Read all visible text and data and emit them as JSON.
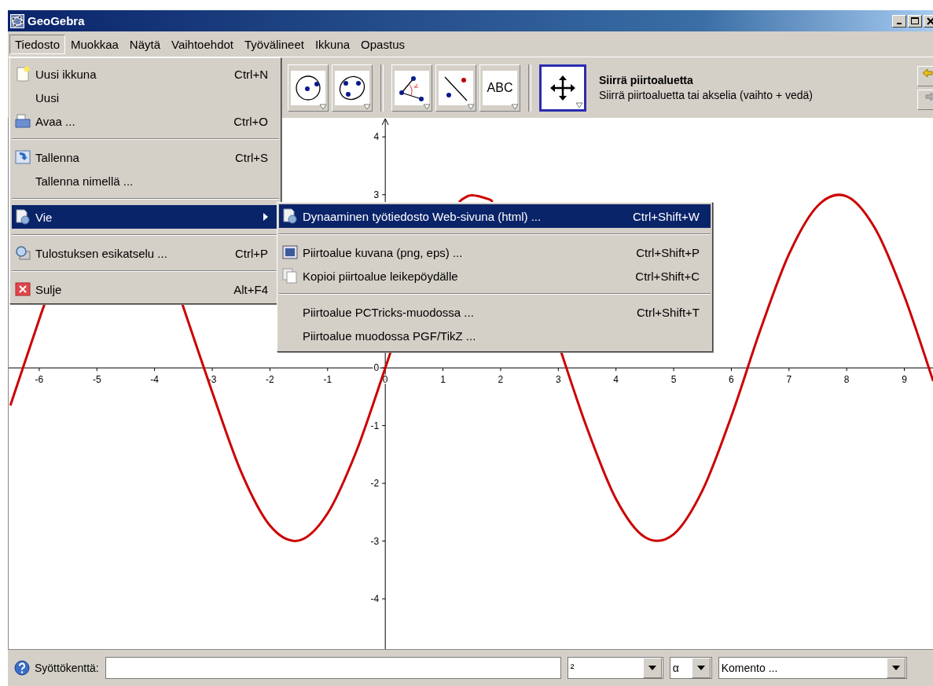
{
  "window": {
    "title": "GeoGebra"
  },
  "menu_bar": [
    {
      "label": "Tiedosto",
      "selected": true
    },
    {
      "label": "Muokkaa",
      "selected": false
    },
    {
      "label": "Näytä",
      "selected": false
    },
    {
      "label": "Vaihtoehdot",
      "selected": false
    },
    {
      "label": "Työvälineet",
      "selected": false
    },
    {
      "label": "Ikkuna",
      "selected": false
    },
    {
      "label": "Opastus",
      "selected": false
    }
  ],
  "file_menu": {
    "groups": [
      [
        {
          "label": "Uusi ikkuna",
          "shortcut": "Ctrl+N",
          "selected": false
        },
        {
          "label": "Uusi",
          "selected": false
        },
        {
          "label": "Avaa ...",
          "shortcut": "Ctrl+O",
          "selected": false
        }
      ],
      [
        {
          "label": "Tallenna",
          "shortcut": "Ctrl+S",
          "selected": false
        },
        {
          "label": "Tallenna nimellä ...",
          "selected": false
        }
      ],
      [
        {
          "label": "Vie",
          "selected": true,
          "submenu": true
        }
      ],
      [
        {
          "label": "Tulostuksen esikatselu ...",
          "shortcut": "Ctrl+P",
          "selected": false
        }
      ],
      [
        {
          "label": "Sulje",
          "shortcut": "Alt+F4",
          "selected": false
        }
      ]
    ]
  },
  "export_submenu": {
    "groups": [
      [
        {
          "label": "Dynaaminen työtiedosto Web-sivuna (html) ...",
          "shortcut": "Ctrl+Shift+W",
          "selected": true
        }
      ],
      [
        {
          "label": "Piirtoalue kuvana (png, eps) ...",
          "shortcut": "Ctrl+Shift+P",
          "selected": false
        },
        {
          "label": "Kopioi piirtoalue leikepöydälle",
          "shortcut": "Ctrl+Shift+C",
          "selected": false
        }
      ],
      [
        {
          "label": "Piirtoalue PCTricks-muodossa ...",
          "shortcut": "Ctrl+Shift+T",
          "selected": false
        },
        {
          "label": "Piirtoalue muodossa PGF/TikZ ...",
          "selected": false
        }
      ]
    ]
  },
  "toolbar": {
    "groups": [
      [
        {
          "selected": false
        },
        {
          "selected": false
        }
      ],
      [
        {
          "selected": false
        },
        {
          "selected": false
        },
        {
          "label": "ABC",
          "selected": false
        }
      ],
      [
        {
          "selected": true
        }
      ]
    ],
    "tool_title": "Siirrä piirtoaluetta",
    "tool_help": "Siirrä piirtoaluetta tai akselia (vaihto + vedä)"
  },
  "graphics": {
    "chart_data": {
      "type": "line",
      "xlim": [
        -6.53,
        9.51
      ],
      "ylim": [
        -4.87,
        4.33
      ],
      "xticks": [
        -6,
        -5,
        -4,
        -3,
        -2,
        -1,
        0,
        1,
        2,
        3,
        4,
        5,
        6,
        7,
        8,
        9
      ],
      "yticks": [
        -4,
        -3,
        -2,
        -1,
        0,
        3,
        4
      ],
      "x": [
        -6.5,
        -6,
        -5.9,
        -5.5,
        -5,
        -4.5,
        -4,
        -3.51,
        -3.5,
        -3,
        -2.5,
        -2,
        -1.5,
        -1,
        -0.5,
        0,
        0.09,
        0.5,
        1,
        1.28,
        1.35,
        1.5,
        1.8,
        1.86,
        2,
        2.5,
        3,
        3.05,
        3.5,
        4,
        4.5,
        5,
        5.5,
        6,
        6.5,
        7,
        7.5,
        8,
        8.5,
        9,
        9.5
      ],
      "series": [
        {
          "color": "#cc0000",
          "values": [
            -0.65,
            0.84,
            1.12,
            null,
            null,
            null,
            null,
            1.08,
            1.05,
            -0.42,
            -1.8,
            -2.73,
            -2.99,
            -2.52,
            -1.44,
            0,
            0.27,
            null,
            null,
            2.87,
            2.93,
            2.99,
            2.92,
            2.87,
            null,
            null,
            null,
            0.27,
            -1.05,
            -2.27,
            -2.93,
            -2.88,
            -2.12,
            -0.84,
            0.65,
            1.97,
            2.81,
            2.97,
            2.4,
            1.24,
            -0.23
          ]
        }
      ]
    }
  },
  "input_bar": {
    "label": "Syöttökenttä:",
    "symbol": "²",
    "greek": "α",
    "command": "Komento ..."
  }
}
